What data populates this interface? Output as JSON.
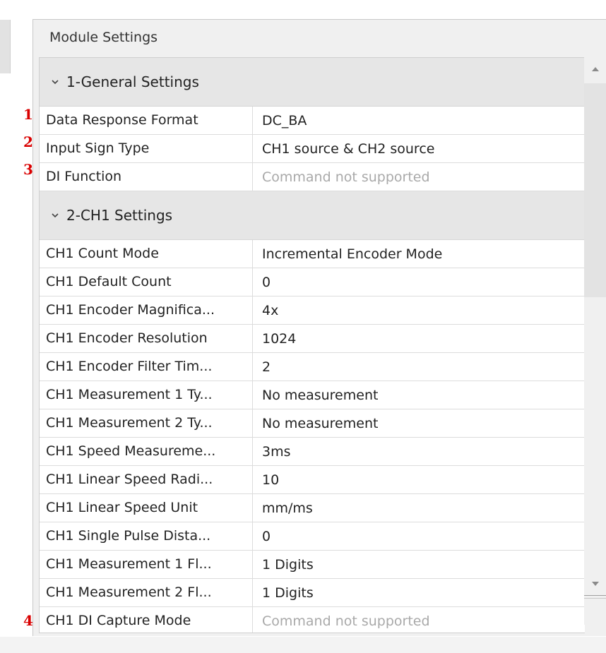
{
  "panel": {
    "title": "Module Settings"
  },
  "sections": [
    {
      "title": "1-General Settings"
    },
    {
      "title": "2-CH1 Settings"
    }
  ],
  "general_rows": [
    {
      "name": "Data Response Format",
      "value": "DC_BA"
    },
    {
      "name": "Input Sign Type",
      "value": "CH1 source & CH2 source"
    },
    {
      "name": "DI Function",
      "value": "Command not supported"
    }
  ],
  "ch1_rows": [
    {
      "name": "CH1 Count Mode",
      "value": "Incremental Encoder Mode"
    },
    {
      "name": "CH1 Default Count",
      "value": "0"
    },
    {
      "name": "CH1 Encoder Magnifica...",
      "value": "4x"
    },
    {
      "name": "CH1 Encoder Resolution",
      "value": "1024"
    },
    {
      "name": "CH1 Encoder Filter Tim...",
      "value": "2"
    },
    {
      "name": "CH1 Measurement 1 Ty...",
      "value": "No measurement"
    },
    {
      "name": "CH1 Measurement 2 Ty...",
      "value": "No measurement"
    },
    {
      "name": "CH1 Speed Measureme...",
      "value": "3ms"
    },
    {
      "name": "CH1 Linear Speed Radi...",
      "value": "10"
    },
    {
      "name": "CH1 Linear Speed Unit",
      "value": "mm/ms"
    },
    {
      "name": "CH1 Single Pulse Dista...",
      "value": "0"
    },
    {
      "name": "CH1 Measurement 1 Fl...",
      "value": "1 Digits"
    },
    {
      "name": "CH1 Measurement 2 Fl...",
      "value": "1 Digits"
    },
    {
      "name": "CH1 DI Capture Mode",
      "value": "Command not supported"
    }
  ],
  "markers": [
    "1",
    "2",
    "3",
    "4"
  ],
  "icons": {
    "section_expand": "chevron-down-icon",
    "scroll_up": "triangle-up-icon",
    "scroll_down": "triangle-down-icon"
  },
  "colors": {
    "marker": "#d90000",
    "disabled_text": "#a9a9a9",
    "section_header_bg": "#e6e6e6"
  }
}
